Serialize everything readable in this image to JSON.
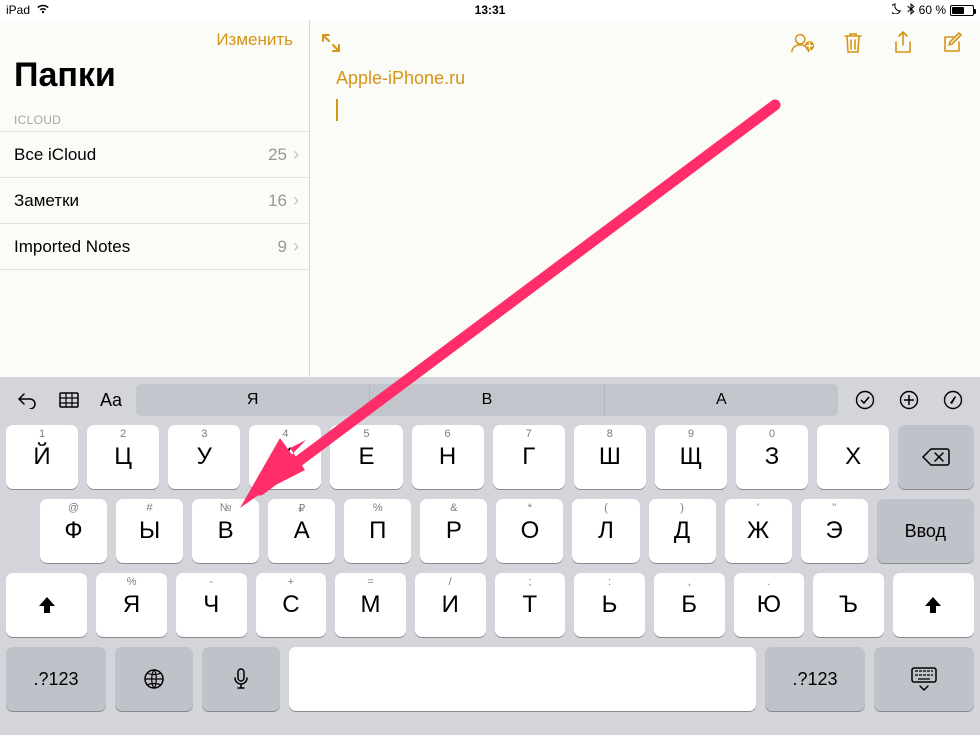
{
  "statusbar": {
    "device": "iPad",
    "time": "13:31",
    "battery_text": "60 %",
    "bt_icon": "bluetooth",
    "dnd_icon": "moon"
  },
  "sidebar": {
    "edit_label": "Изменить",
    "title": "Папки",
    "section": "ICLOUD",
    "folders": [
      {
        "name": "Все iCloud",
        "count": "25"
      },
      {
        "name": "Заметки",
        "count": "16"
      },
      {
        "name": "Imported Notes",
        "count": "9"
      }
    ]
  },
  "note": {
    "title_link": "Apple-iPhone.ru"
  },
  "keyboard": {
    "suggestions": [
      "Я",
      "В",
      "А"
    ],
    "row1": [
      {
        "main": "Й",
        "alt": "1"
      },
      {
        "main": "Ц",
        "alt": "2"
      },
      {
        "main": "У",
        "alt": "3"
      },
      {
        "main": "К",
        "alt": "4"
      },
      {
        "main": "Е",
        "alt": "5"
      },
      {
        "main": "Н",
        "alt": "6"
      },
      {
        "main": "Г",
        "alt": "7"
      },
      {
        "main": "Ш",
        "alt": "8"
      },
      {
        "main": "Щ",
        "alt": "9"
      },
      {
        "main": "З",
        "alt": "0"
      },
      {
        "main": "Х",
        "alt": ""
      }
    ],
    "row2": [
      {
        "main": "Ф",
        "alt": "@"
      },
      {
        "main": "Ы",
        "alt": "#"
      },
      {
        "main": "В",
        "alt": "№"
      },
      {
        "main": "А",
        "alt": "₽"
      },
      {
        "main": "П",
        "alt": "%"
      },
      {
        "main": "Р",
        "alt": "&"
      },
      {
        "main": "О",
        "alt": "*"
      },
      {
        "main": "Л",
        "alt": "("
      },
      {
        "main": "Д",
        "alt": ")"
      },
      {
        "main": "Ж",
        "alt": "'"
      },
      {
        "main": "Э",
        "alt": "\""
      }
    ],
    "enter_label": "Ввод",
    "row3": [
      {
        "main": "Я",
        "alt": "%"
      },
      {
        "main": "Ч",
        "alt": "-"
      },
      {
        "main": "С",
        "alt": "+"
      },
      {
        "main": "М",
        "alt": "="
      },
      {
        "main": "И",
        "alt": "/"
      },
      {
        "main": "Т",
        "alt": ";"
      },
      {
        "main": "Ь",
        "alt": ":"
      },
      {
        "main": "Б",
        "alt": ","
      },
      {
        "main": "Ю",
        "alt": "."
      },
      {
        "main": "Ъ",
        "alt": ""
      }
    ],
    "sym_label": ".?123"
  }
}
